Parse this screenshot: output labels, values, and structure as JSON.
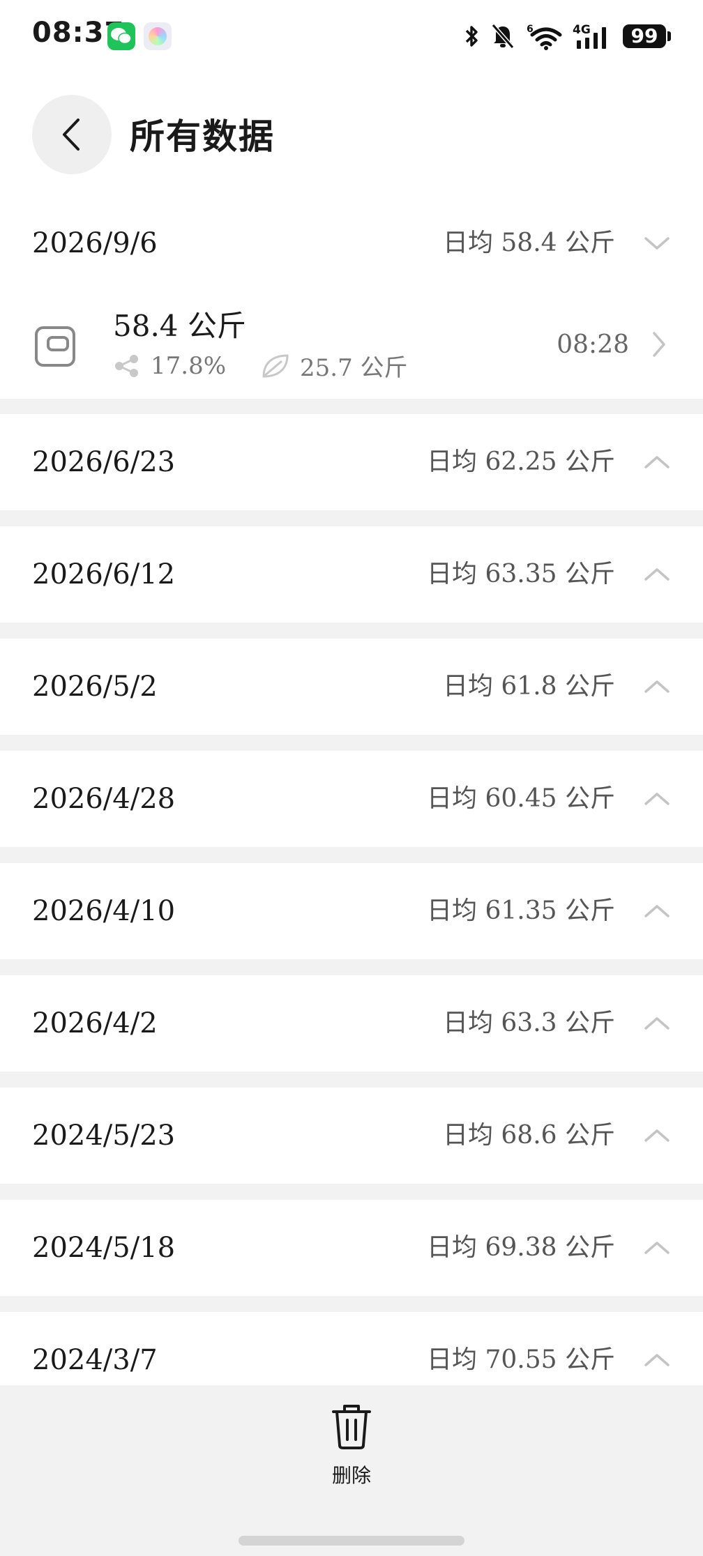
{
  "status_bar": {
    "time": "08:37",
    "network": "4G",
    "wifi_badge": "6",
    "battery": "99"
  },
  "header": {
    "title": "所有数据"
  },
  "days": [
    {
      "date": "2026/9/6",
      "avg_label": "日均 58.4 公斤",
      "expanded": true,
      "entry": {
        "weight": "58.4 公斤",
        "body_fat": "17.8%",
        "muscle": "25.7 公斤",
        "time": "08:28"
      }
    },
    {
      "date": "2026/6/23",
      "avg_label": "日均 62.25 公斤",
      "expanded": false
    },
    {
      "date": "2026/6/12",
      "avg_label": "日均 63.35 公斤",
      "expanded": false
    },
    {
      "date": "2026/5/2",
      "avg_label": "日均 61.8 公斤",
      "expanded": false
    },
    {
      "date": "2026/4/28",
      "avg_label": "日均 60.45 公斤",
      "expanded": false
    },
    {
      "date": "2026/4/10",
      "avg_label": "日均 61.35 公斤",
      "expanded": false
    },
    {
      "date": "2026/4/2",
      "avg_label": "日均 63.3 公斤",
      "expanded": false
    },
    {
      "date": "2024/5/23",
      "avg_label": "日均 68.6 公斤",
      "expanded": false
    },
    {
      "date": "2024/5/18",
      "avg_label": "日均 69.38 公斤",
      "expanded": false
    },
    {
      "date": "2024/3/7",
      "avg_label": "日均 70.55 公斤",
      "expanded": false
    }
  ],
  "bottom_bar": {
    "delete_label": "删除"
  }
}
